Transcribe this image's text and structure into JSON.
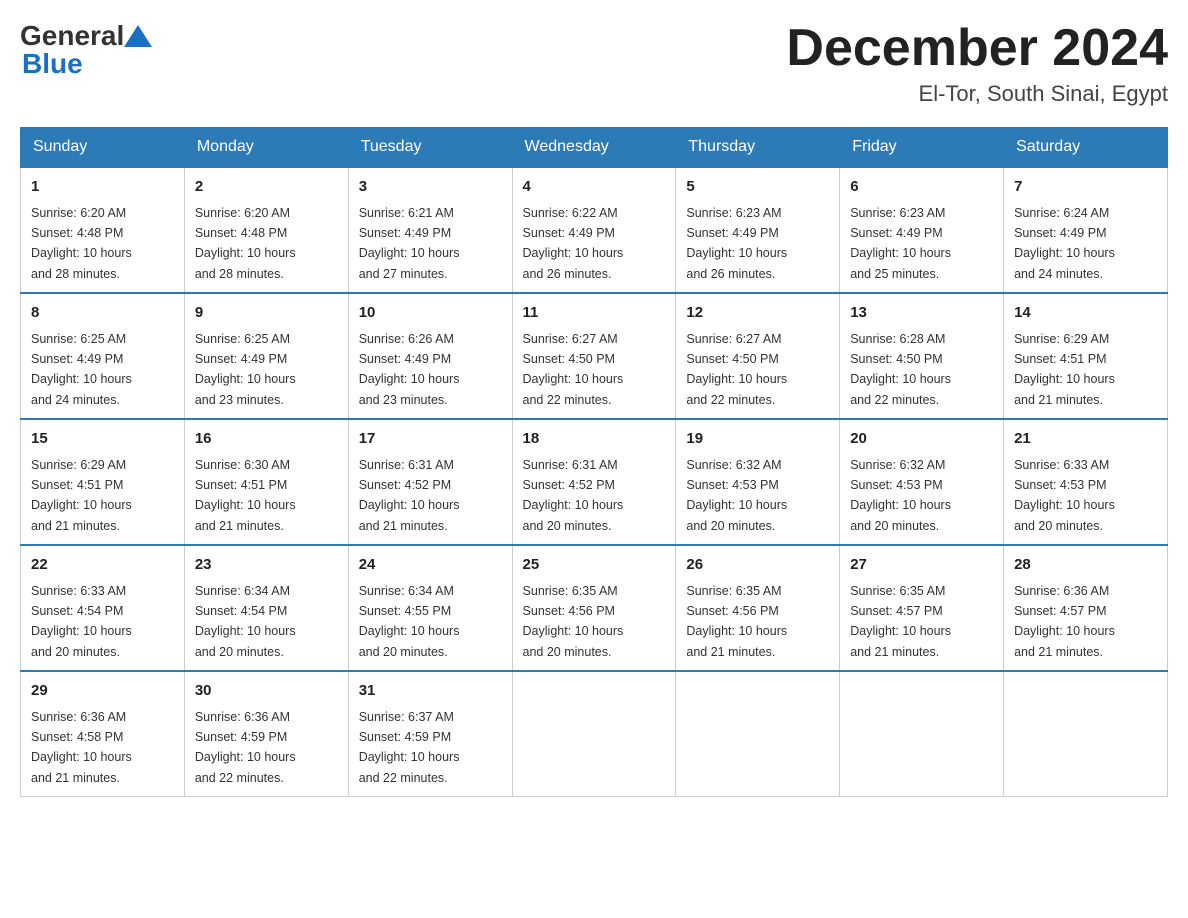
{
  "logo": {
    "general": "General",
    "blue": "Blue"
  },
  "header": {
    "month": "December 2024",
    "location": "El-Tor, South Sinai, Egypt"
  },
  "weekdays": [
    "Sunday",
    "Monday",
    "Tuesday",
    "Wednesday",
    "Thursday",
    "Friday",
    "Saturday"
  ],
  "weeks": [
    [
      {
        "day": "1",
        "sunrise": "6:20 AM",
        "sunset": "4:48 PM",
        "daylight": "10 hours and 28 minutes."
      },
      {
        "day": "2",
        "sunrise": "6:20 AM",
        "sunset": "4:48 PM",
        "daylight": "10 hours and 28 minutes."
      },
      {
        "day": "3",
        "sunrise": "6:21 AM",
        "sunset": "4:49 PM",
        "daylight": "10 hours and 27 minutes."
      },
      {
        "day": "4",
        "sunrise": "6:22 AM",
        "sunset": "4:49 PM",
        "daylight": "10 hours and 26 minutes."
      },
      {
        "day": "5",
        "sunrise": "6:23 AM",
        "sunset": "4:49 PM",
        "daylight": "10 hours and 26 minutes."
      },
      {
        "day": "6",
        "sunrise": "6:23 AM",
        "sunset": "4:49 PM",
        "daylight": "10 hours and 25 minutes."
      },
      {
        "day": "7",
        "sunrise": "6:24 AM",
        "sunset": "4:49 PM",
        "daylight": "10 hours and 24 minutes."
      }
    ],
    [
      {
        "day": "8",
        "sunrise": "6:25 AM",
        "sunset": "4:49 PM",
        "daylight": "10 hours and 24 minutes."
      },
      {
        "day": "9",
        "sunrise": "6:25 AM",
        "sunset": "4:49 PM",
        "daylight": "10 hours and 23 minutes."
      },
      {
        "day": "10",
        "sunrise": "6:26 AM",
        "sunset": "4:49 PM",
        "daylight": "10 hours and 23 minutes."
      },
      {
        "day": "11",
        "sunrise": "6:27 AM",
        "sunset": "4:50 PM",
        "daylight": "10 hours and 22 minutes."
      },
      {
        "day": "12",
        "sunrise": "6:27 AM",
        "sunset": "4:50 PM",
        "daylight": "10 hours and 22 minutes."
      },
      {
        "day": "13",
        "sunrise": "6:28 AM",
        "sunset": "4:50 PM",
        "daylight": "10 hours and 22 minutes."
      },
      {
        "day": "14",
        "sunrise": "6:29 AM",
        "sunset": "4:51 PM",
        "daylight": "10 hours and 21 minutes."
      }
    ],
    [
      {
        "day": "15",
        "sunrise": "6:29 AM",
        "sunset": "4:51 PM",
        "daylight": "10 hours and 21 minutes."
      },
      {
        "day": "16",
        "sunrise": "6:30 AM",
        "sunset": "4:51 PM",
        "daylight": "10 hours and 21 minutes."
      },
      {
        "day": "17",
        "sunrise": "6:31 AM",
        "sunset": "4:52 PM",
        "daylight": "10 hours and 21 minutes."
      },
      {
        "day": "18",
        "sunrise": "6:31 AM",
        "sunset": "4:52 PM",
        "daylight": "10 hours and 20 minutes."
      },
      {
        "day": "19",
        "sunrise": "6:32 AM",
        "sunset": "4:53 PM",
        "daylight": "10 hours and 20 minutes."
      },
      {
        "day": "20",
        "sunrise": "6:32 AM",
        "sunset": "4:53 PM",
        "daylight": "10 hours and 20 minutes."
      },
      {
        "day": "21",
        "sunrise": "6:33 AM",
        "sunset": "4:53 PM",
        "daylight": "10 hours and 20 minutes."
      }
    ],
    [
      {
        "day": "22",
        "sunrise": "6:33 AM",
        "sunset": "4:54 PM",
        "daylight": "10 hours and 20 minutes."
      },
      {
        "day": "23",
        "sunrise": "6:34 AM",
        "sunset": "4:54 PM",
        "daylight": "10 hours and 20 minutes."
      },
      {
        "day": "24",
        "sunrise": "6:34 AM",
        "sunset": "4:55 PM",
        "daylight": "10 hours and 20 minutes."
      },
      {
        "day": "25",
        "sunrise": "6:35 AM",
        "sunset": "4:56 PM",
        "daylight": "10 hours and 20 minutes."
      },
      {
        "day": "26",
        "sunrise": "6:35 AM",
        "sunset": "4:56 PM",
        "daylight": "10 hours and 21 minutes."
      },
      {
        "day": "27",
        "sunrise": "6:35 AM",
        "sunset": "4:57 PM",
        "daylight": "10 hours and 21 minutes."
      },
      {
        "day": "28",
        "sunrise": "6:36 AM",
        "sunset": "4:57 PM",
        "daylight": "10 hours and 21 minutes."
      }
    ],
    [
      {
        "day": "29",
        "sunrise": "6:36 AM",
        "sunset": "4:58 PM",
        "daylight": "10 hours and 21 minutes."
      },
      {
        "day": "30",
        "sunrise": "6:36 AM",
        "sunset": "4:59 PM",
        "daylight": "10 hours and 22 minutes."
      },
      {
        "day": "31",
        "sunrise": "6:37 AM",
        "sunset": "4:59 PM",
        "daylight": "10 hours and 22 minutes."
      },
      null,
      null,
      null,
      null
    ]
  ],
  "labels": {
    "sunrise": "Sunrise:",
    "sunset": "Sunset:",
    "daylight": "Daylight:"
  }
}
